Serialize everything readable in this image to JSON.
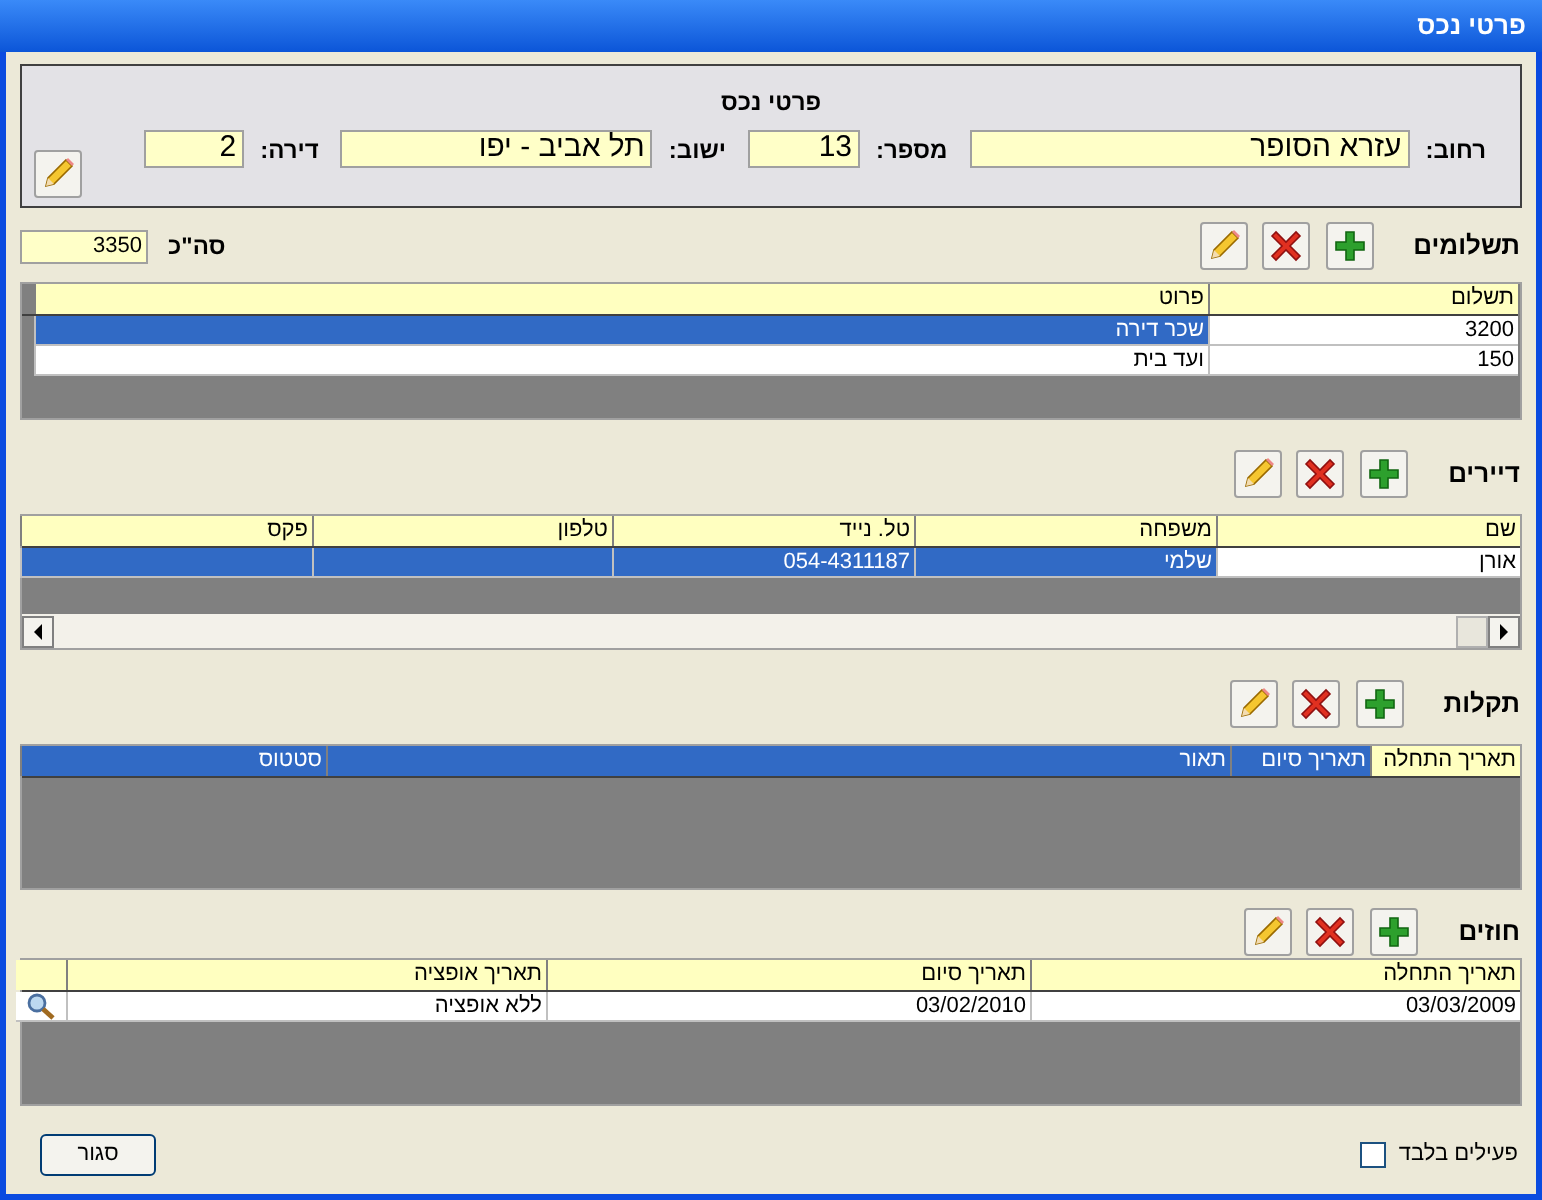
{
  "window": {
    "title": "פרטי נכס"
  },
  "property": {
    "title": "פרטי נכס",
    "fields": [
      {
        "label": "רחוב:",
        "value": "עזרא הסופר"
      },
      {
        "label": "מספר:",
        "value": "13"
      },
      {
        "label": "ישוב:",
        "value": "תל אביב - יפו"
      },
      {
        "label": "דירה:",
        "value": "2"
      }
    ]
  },
  "sections": [
    {
      "title": "תשלומים",
      "total": {
        "label": "סה\"כ",
        "value": "3350"
      },
      "columns": [
        {
          "label": "תשלום"
        },
        {
          "label": "פרוט"
        }
      ],
      "rows": [
        {
          "selected": true,
          "cells": [
            "3200",
            "שכר דירה"
          ]
        },
        {
          "selected": false,
          "cells": [
            "150",
            "ועד בית"
          ]
        }
      ]
    },
    {
      "title": "דיירים",
      "columns": [
        {
          "label": "שם"
        },
        {
          "label": "משפחה"
        },
        {
          "label": "טל. נייד"
        },
        {
          "label": "טלפון"
        },
        {
          "label": "פקס"
        }
      ],
      "rows": [
        {
          "selected": true,
          "cells": [
            "אורן",
            "שלמי",
            "054-4311187",
            "",
            ""
          ]
        }
      ]
    },
    {
      "title": "תקלות",
      "columns": [
        {
          "label": "תאריך התחלה",
          "selected": false
        },
        {
          "label": "תאריך סיום",
          "selected": true
        },
        {
          "label": "תאור",
          "selected": true
        },
        {
          "label": "סטטוס",
          "selected": true
        }
      ]
    },
    {
      "title": "חוזים",
      "details_column": true,
      "columns": [
        {
          "label": "תאריך התחלה"
        },
        {
          "label": "תאריך סיום"
        },
        {
          "label": "תאריך אופציה"
        }
      ],
      "rows": [
        {
          "selected": false,
          "cells": [
            "03/03/2009",
            "03/02/2010",
            "ללא אופציה"
          ]
        }
      ]
    }
  ],
  "active_only": {
    "label": "פעילים בלבד",
    "checked": false
  },
  "close_button": "סגור"
}
